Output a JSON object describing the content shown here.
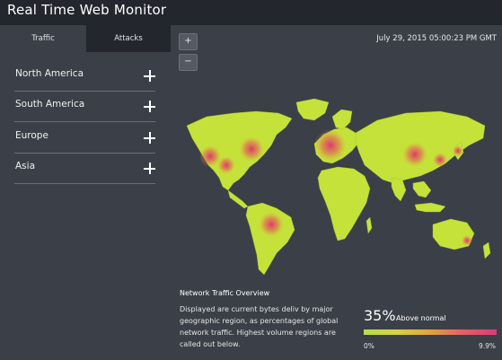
{
  "app": {
    "title": "Real Time Web Monitor"
  },
  "tabs": [
    {
      "label": "Traffic",
      "selected": true
    },
    {
      "label": "Attacks",
      "selected": false
    }
  ],
  "regions": [
    {
      "label": "North America"
    },
    {
      "label": "South America"
    },
    {
      "label": "Europe"
    },
    {
      "label": "Asia"
    }
  ],
  "zoom": {
    "in_label": "+",
    "out_label": "−"
  },
  "datetime": "July 29, 2015 05:00:23 PM GMT",
  "overview": {
    "title": "Network Traffic Overview",
    "text": "Displayed are current bytes deliv by major geographic region, as percentages of global network traffic. Highest volume regions are called out below."
  },
  "legend": {
    "percent": "35%",
    "percent_label": "Above normal",
    "min": "0%",
    "max": "9.9%"
  },
  "colors": {
    "land": "#c5e23a",
    "hotspot": "#e0306e",
    "background": "#3b4048",
    "titlebar": "#23272d"
  }
}
